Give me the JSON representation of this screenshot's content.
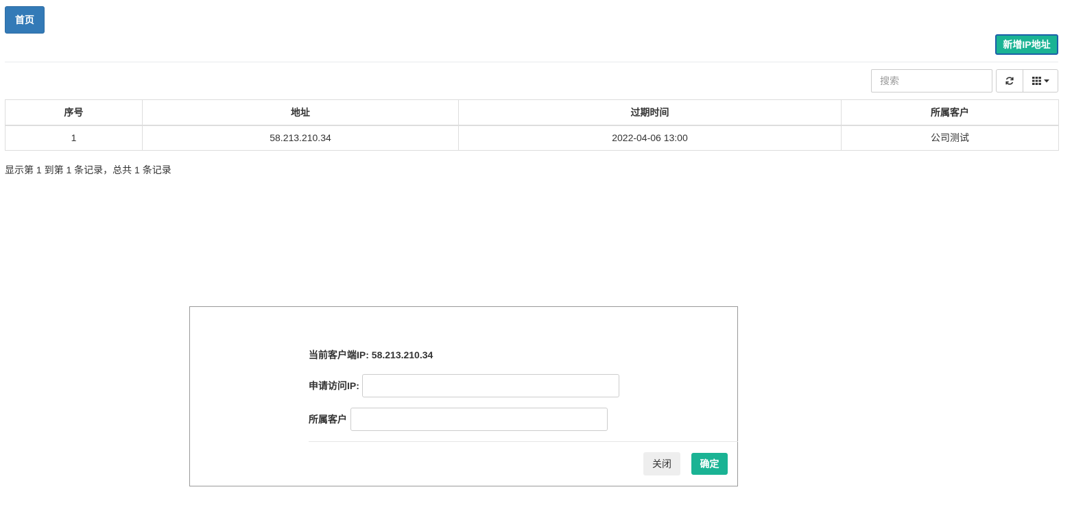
{
  "header": {
    "home_label": "首页",
    "add_ip_label": "新增IP地址"
  },
  "toolbar": {
    "search_placeholder": "搜索",
    "refresh_icon": "refresh-icon",
    "columns_icon": "grid-icon"
  },
  "table": {
    "columns": [
      "序号",
      "地址",
      "过期时间",
      "所属客户"
    ],
    "rows": [
      [
        "1",
        "58.213.210.34",
        "2022-04-06 13:00",
        "公司测试"
      ]
    ]
  },
  "pagination": {
    "info": "显示第 1 到第 1 条记录，总共 1 条记录"
  },
  "modal": {
    "client_ip_text": "当前客户端IP: 58.213.210.34",
    "apply_ip_label": "申请访问IP:",
    "apply_ip_value": "",
    "customer_label": "所属客户",
    "customer_value": "",
    "close_label": "关闭",
    "confirm_label": "确定"
  },
  "colors": {
    "primary": "#337ab7",
    "success": "#1ab394"
  }
}
